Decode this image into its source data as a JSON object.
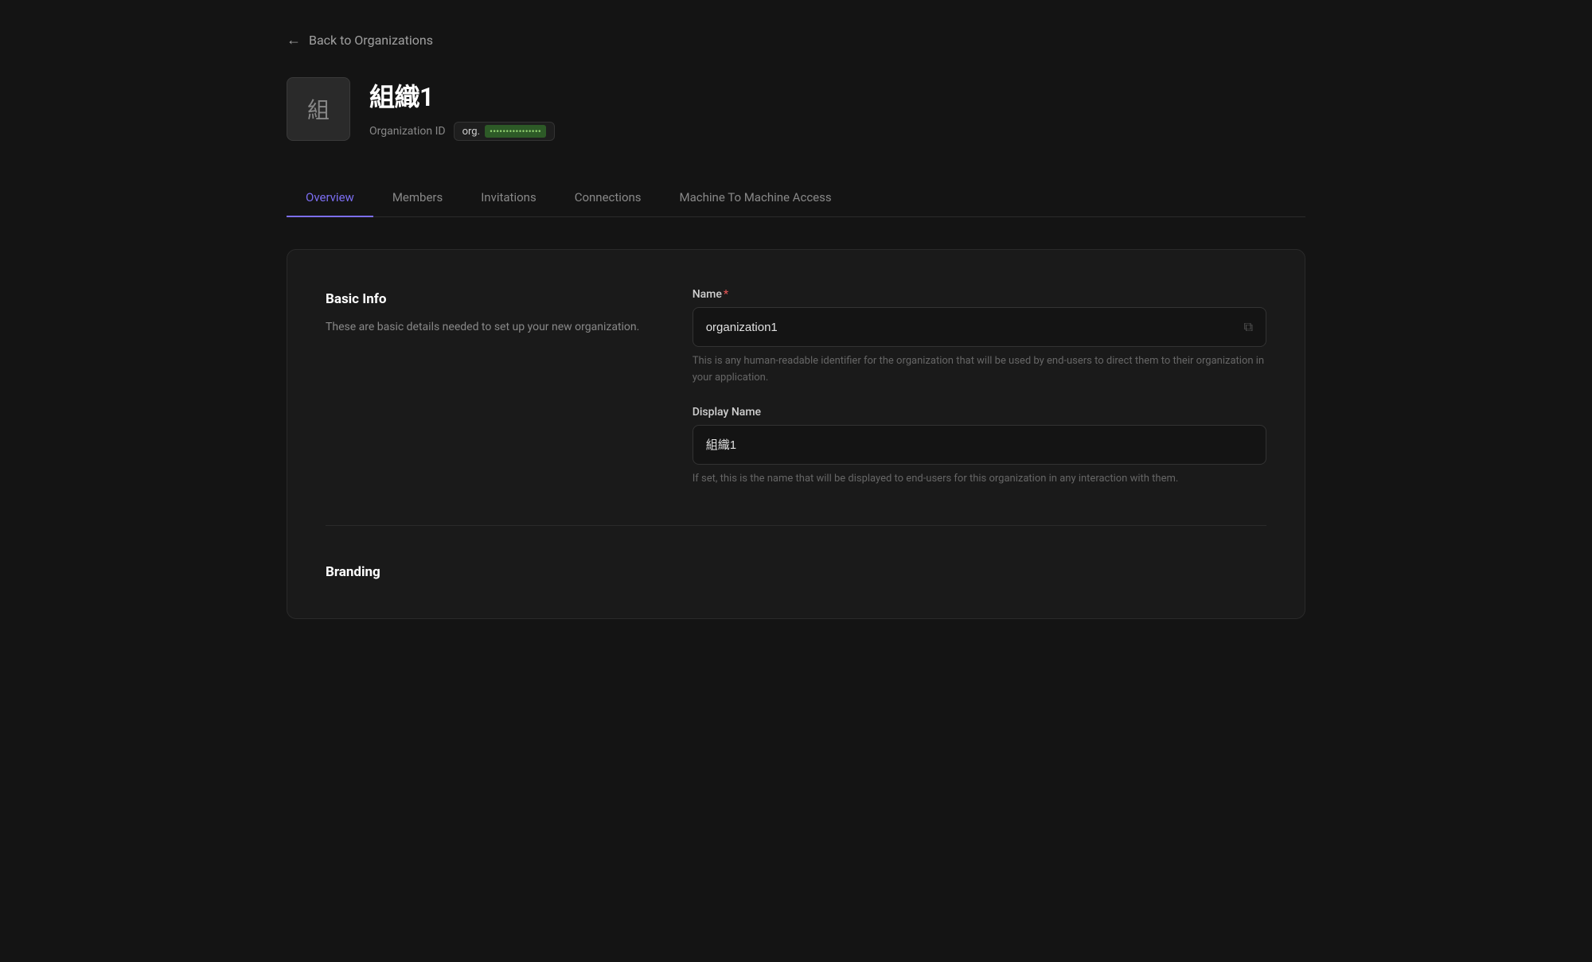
{
  "back_link": {
    "label": "Back to Organizations",
    "arrow": "←"
  },
  "organization": {
    "avatar_char": "組",
    "name": "組織1",
    "id_label": "Organization ID",
    "id_prefix": "org.",
    "id_value": "••••••••••••••••"
  },
  "tabs": [
    {
      "id": "overview",
      "label": "Overview",
      "active": true
    },
    {
      "id": "members",
      "label": "Members",
      "active": false
    },
    {
      "id": "invitations",
      "label": "Invitations",
      "active": false
    },
    {
      "id": "connections",
      "label": "Connections",
      "active": false
    },
    {
      "id": "machine-to-machine",
      "label": "Machine To Machine Access",
      "active": false
    }
  ],
  "basic_info": {
    "section_title": "Basic Info",
    "section_desc": "These are basic details needed to set up your new organization.",
    "name_label": "Name",
    "name_required": "*",
    "name_value": "organization1",
    "name_hint": "This is any human-readable identifier for the organization that will be used by end-users to direct them to their organization in your application.",
    "display_name_label": "Display Name",
    "display_name_value": "組織1",
    "display_name_hint": "If set, this is the name that will be displayed to end-users for this organization in any interaction with them.",
    "copy_icon": "⧉"
  },
  "branding": {
    "section_title": "Branding"
  },
  "colors": {
    "accent": "#7c6ef2",
    "bg_dark": "#141414",
    "bg_card": "#1a1a1a",
    "border": "#2a2a2a",
    "text_muted": "#888888",
    "org_id_bg": "#2d5a27",
    "org_id_text": "#8fce6f"
  }
}
